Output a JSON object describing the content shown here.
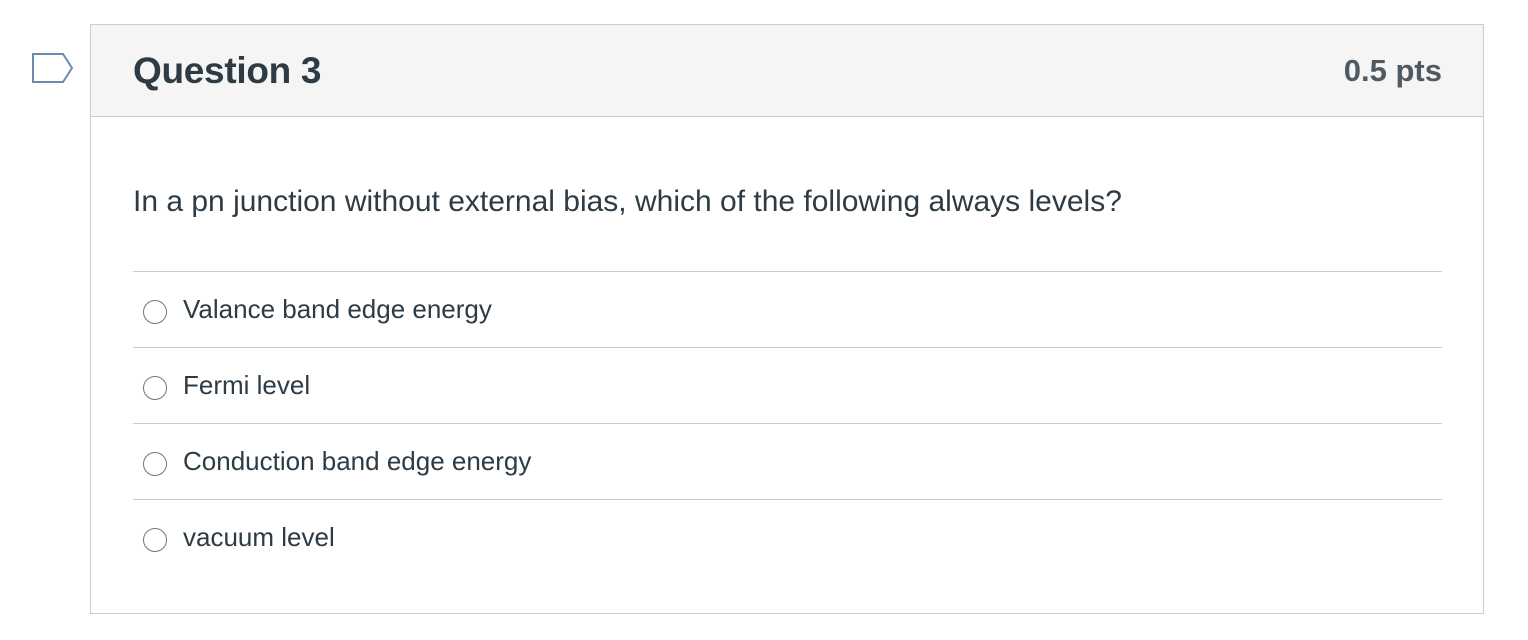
{
  "flag": {
    "icon": "flag-outline-icon",
    "stroke_color": "#6b8cae"
  },
  "question": {
    "title": "Question 3",
    "points": "0.5 pts",
    "text": "In a pn junction without external bias, which of the following always levels?",
    "answers": [
      {
        "label": "Valance band edge energy",
        "selected": false
      },
      {
        "label": "Fermi level",
        "selected": false
      },
      {
        "label": "Conduction band edge energy",
        "selected": false
      },
      {
        "label": "vacuum level",
        "selected": false
      }
    ]
  },
  "colors": {
    "header_bg": "#f5f5f5",
    "border": "#c7cdd1",
    "text": "#2d3b45"
  }
}
